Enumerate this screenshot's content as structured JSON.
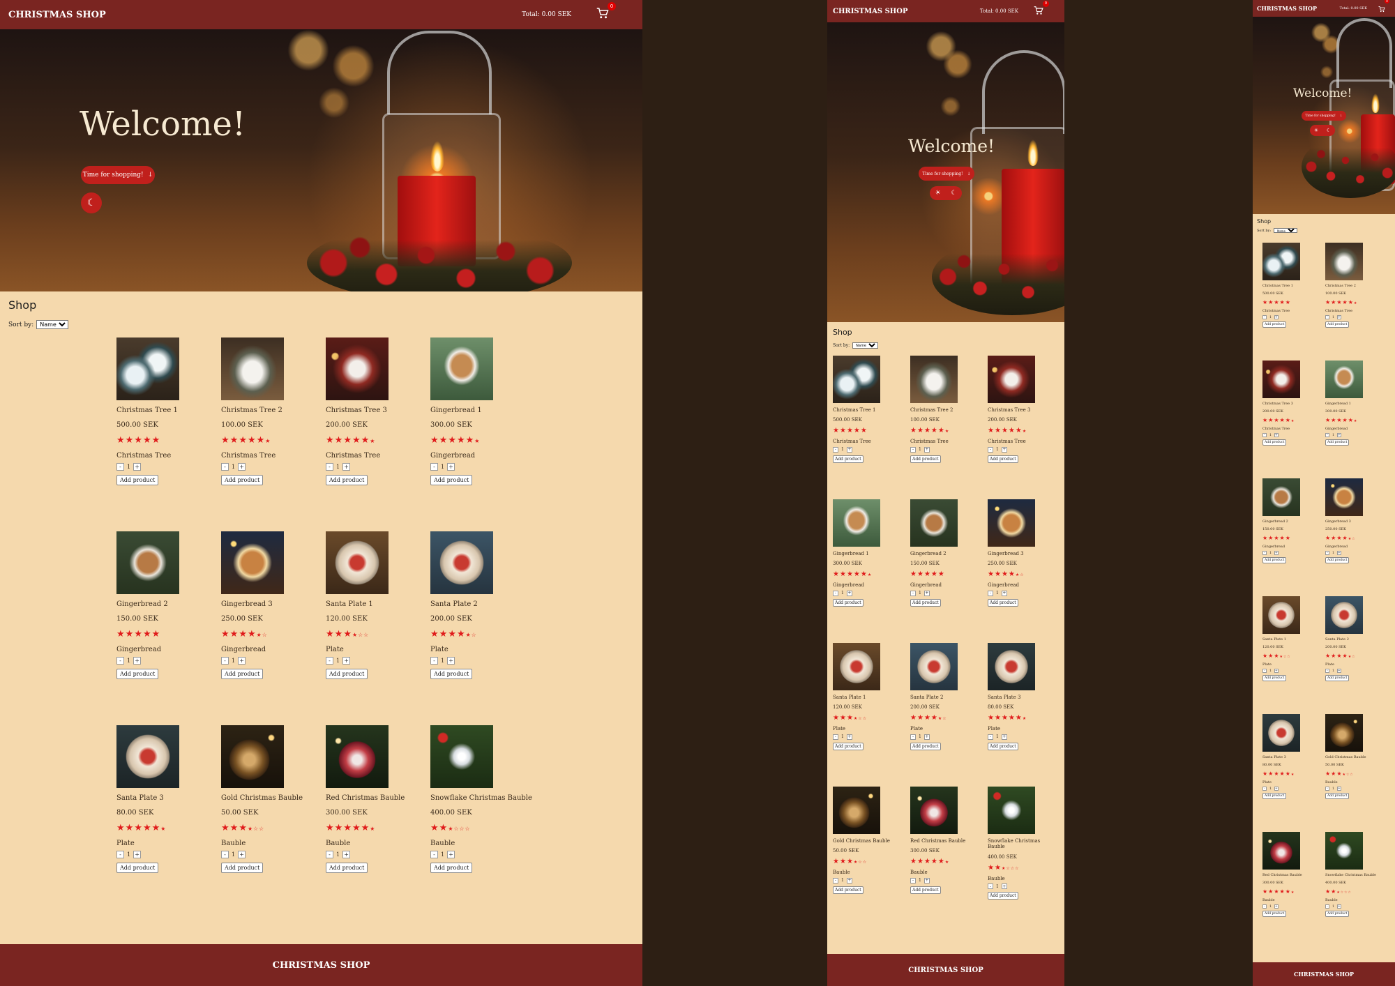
{
  "header": {
    "brand": "CHRISTMAS SHOP",
    "total_label": "Total: 0.00 SEK",
    "cart_count": "0"
  },
  "hero": {
    "welcome": "Welcome!",
    "shop_button": "Time for shopping!",
    "light_icon": "sun-icon",
    "dark_icon": "moon-icon"
  },
  "shop": {
    "title": "Shop",
    "sort_label": "Sort by:",
    "sort_value": "Name",
    "add_label": "Add product",
    "qty_value": "1",
    "minus": "-",
    "plus": "+"
  },
  "footer": {
    "brand": "CHRISTMAS SHOP"
  },
  "colors": {
    "header_bg": "#7a2521",
    "page_bg": "#f5d9ad",
    "accent": "#c0201c",
    "star": "#e01b1b"
  },
  "products": [
    {
      "name": "Christmas Tree 1",
      "price": "500.00 SEK",
      "rating": 5,
      "category": "Christmas Tree",
      "theme": "tree-blue"
    },
    {
      "name": "Christmas Tree 2",
      "price": "100.00 SEK",
      "rating": 4.5,
      "category": "Christmas Tree",
      "theme": "tree-white"
    },
    {
      "name": "Christmas Tree 3",
      "price": "200.00 SEK",
      "rating": 4.5,
      "category": "Christmas Tree",
      "theme": "tree-red"
    },
    {
      "name": "Gingerbread 1",
      "price": "300.00 SEK",
      "rating": 4.5,
      "category": "Gingerbread",
      "theme": "ginger-snow"
    },
    {
      "name": "Gingerbread 2",
      "price": "150.00 SEK",
      "rating": 5,
      "category": "Gingerbread",
      "theme": "ginger-green"
    },
    {
      "name": "Gingerbread 3",
      "price": "250.00 SEK",
      "rating": 3.5,
      "category": "Gingerbread",
      "theme": "ginger-night"
    },
    {
      "name": "Santa Plate 1",
      "price": "120.00 SEK",
      "rating": 2.5,
      "category": "Plate",
      "theme": "plate-brown"
    },
    {
      "name": "Santa Plate 2",
      "price": "200.00 SEK",
      "rating": 3.5,
      "category": "Plate",
      "theme": "plate-blue"
    },
    {
      "name": "Santa Plate 3",
      "price": "80.00 SEK",
      "rating": 4.5,
      "category": "Plate",
      "theme": "plate-dark"
    },
    {
      "name": "Gold Christmas Bauble",
      "price": "50.00 SEK",
      "rating": 2.5,
      "category": "Bauble",
      "theme": "bauble-gold"
    },
    {
      "name": "Red Christmas Bauble",
      "price": "300.00 SEK",
      "rating": 4.5,
      "category": "Bauble",
      "theme": "bauble-red"
    },
    {
      "name": "Snowflake Christmas Bauble",
      "price": "400.00 SEK",
      "rating": 1.5,
      "category": "Bauble",
      "theme": "bauble-snow"
    }
  ]
}
